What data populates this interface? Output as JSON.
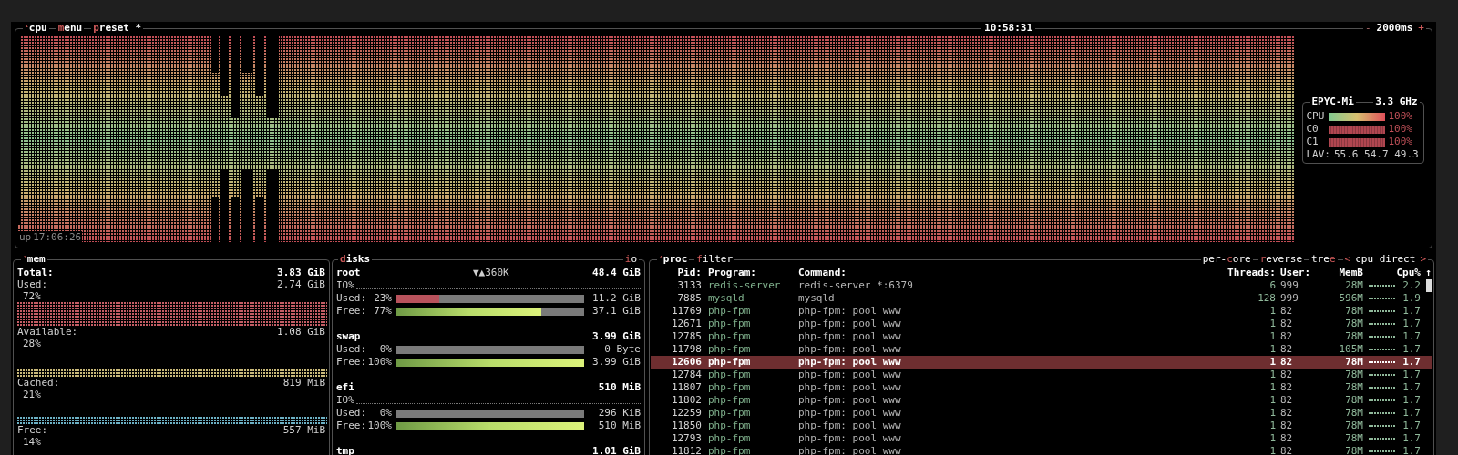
{
  "cpu_panel": {
    "number": "¹",
    "title": "cpu",
    "buttons": [
      {
        "key": "m",
        "label": "enu"
      },
      {
        "key": "p",
        "label": "reset *"
      }
    ],
    "clock": "10:58:31",
    "interval": {
      "minus": "-",
      "value": "2000ms",
      "plus": "+"
    },
    "uptime_label": "up",
    "uptime": "17:06:26",
    "info": {
      "model": "EPYC-Mi",
      "freq": "3.3 GHz",
      "meters": [
        {
          "label": "CPU",
          "kind": "gradient",
          "level": 1,
          "reading": "100%"
        },
        {
          "label": "C0",
          "kind": "dots",
          "level": 1,
          "reading": "100%"
        },
        {
          "label": "C1",
          "kind": "dots",
          "level": 1,
          "reading": "100%"
        }
      ],
      "load_label": "LAV:",
      "load": "55.6 54.7 49.3"
    }
  },
  "mem_panel": {
    "number": "²",
    "title": "mem",
    "total_label": "Total:",
    "total": "3.83 GiB",
    "items": [
      {
        "label": "Used:",
        "value": "2.74 GiB",
        "percent": "72%",
        "color": "#c45c64"
      },
      {
        "label": "Available:",
        "value": "1.08 GiB",
        "percent": "28%",
        "color": "#c9b97a"
      },
      {
        "label": "Cached:",
        "value": "819 MiB",
        "percent": "21%",
        "color": "#6cb0c4"
      },
      {
        "label": "Free:",
        "value": "557 MiB",
        "percent": "14%"
      }
    ]
  },
  "disks_panel": {
    "title_key": "d",
    "title": "isks",
    "io_key": "i",
    "io": "o",
    "disks": [
      {
        "name": "root",
        "io_speed": "▼▲360K",
        "size": "48.4 GiB",
        "io_label": "IO%",
        "meters": [
          {
            "kind": "used",
            "label": "Used:",
            "percent": "23%",
            "level": 0.23,
            "value": "11.2 GiB"
          },
          {
            "kind": "free",
            "label": "Free:",
            "percent": "77%",
            "level": 0.77,
            "value": "37.1 GiB"
          }
        ]
      },
      {
        "name": "swap",
        "size": "3.99 GiB",
        "meters": [
          {
            "kind": "used",
            "label": "Used:",
            "percent": "0%",
            "level": 0,
            "value": "0 Byte"
          },
          {
            "kind": "free",
            "label": "Free:",
            "percent": "100%",
            "level": 1,
            "value": "3.99 GiB"
          }
        ]
      },
      {
        "name": "efi",
        "size": "510 MiB",
        "io_label": "IO%",
        "meters": [
          {
            "kind": "used",
            "label": "Used:",
            "percent": "0%",
            "level": 0,
            "value": "296 KiB"
          },
          {
            "kind": "free",
            "label": "Free:",
            "percent": "100%",
            "level": 1,
            "value": "510 MiB"
          }
        ]
      },
      {
        "name": "tmp",
        "size": "1.01 GiB"
      }
    ]
  },
  "proc_panel": {
    "number": "⁴",
    "title": "proc",
    "filter": {
      "key": "f",
      "label": "ilter"
    },
    "options": [
      {
        "pre": "per-",
        "key": "c",
        "post": "ore"
      },
      {
        "key": "r",
        "post": "everse"
      },
      {
        "pre": "tre",
        "key": "e"
      }
    ],
    "sort": {
      "prev": "<",
      "label": "cpu direct",
      "next": ">"
    },
    "columns": [
      "Pid:",
      "Program:",
      "Command:",
      "Threads:",
      "User:",
      "MemB",
      "Cpu%"
    ],
    "sort_arrow": "↑",
    "rows": [
      {
        "pid": "3133",
        "program": "redis-server",
        "command": "redis-server *:6379",
        "threads": "6",
        "user": "999",
        "mem": "28M",
        "cpu": "2.2",
        "selected": false
      },
      {
        "pid": "7885",
        "program": "mysqld",
        "command": "mysqld",
        "threads": "128",
        "user": "999",
        "mem": "596M",
        "cpu": "1.9",
        "selected": false
      },
      {
        "pid": "11769",
        "program": "php-fpm",
        "command": "php-fpm: pool www",
        "threads": "1",
        "user": "82",
        "mem": "78M",
        "cpu": "1.7",
        "selected": false
      },
      {
        "pid": "12671",
        "program": "php-fpm",
        "command": "php-fpm: pool www",
        "threads": "1",
        "user": "82",
        "mem": "78M",
        "cpu": "1.7",
        "selected": false
      },
      {
        "pid": "12785",
        "program": "php-fpm",
        "command": "php-fpm: pool www",
        "threads": "1",
        "user": "82",
        "mem": "78M",
        "cpu": "1.7",
        "selected": false
      },
      {
        "pid": "11798",
        "program": "php-fpm",
        "command": "php-fpm: pool www",
        "threads": "1",
        "user": "82",
        "mem": "105M",
        "cpu": "1.7",
        "selected": false
      },
      {
        "pid": "12606",
        "program": "php-fpm",
        "command": "php-fpm: pool www",
        "threads": "1",
        "user": "82",
        "mem": "78M",
        "cpu": "1.7",
        "selected": true
      },
      {
        "pid": "12784",
        "program": "php-fpm",
        "command": "php-fpm: pool www",
        "threads": "1",
        "user": "82",
        "mem": "78M",
        "cpu": "1.7",
        "selected": false
      },
      {
        "pid": "11807",
        "program": "php-fpm",
        "command": "php-fpm: pool www",
        "threads": "1",
        "user": "82",
        "mem": "78M",
        "cpu": "1.7",
        "selected": false
      },
      {
        "pid": "11802",
        "program": "php-fpm",
        "command": "php-fpm: pool www",
        "threads": "1",
        "user": "82",
        "mem": "78M",
        "cpu": "1.7",
        "selected": false
      },
      {
        "pid": "12259",
        "program": "php-fpm",
        "command": "php-fpm: pool www",
        "threads": "1",
        "user": "82",
        "mem": "78M",
        "cpu": "1.7",
        "selected": false
      },
      {
        "pid": "11850",
        "program": "php-fpm",
        "command": "php-fpm: pool www",
        "threads": "1",
        "user": "82",
        "mem": "78M",
        "cpu": "1.7",
        "selected": false
      },
      {
        "pid": "12793",
        "program": "php-fpm",
        "command": "php-fpm: pool www",
        "threads": "1",
        "user": "82",
        "mem": "78M",
        "cpu": "1.7",
        "selected": false
      },
      {
        "pid": "11812",
        "program": "php-fpm",
        "command": "php-fpm: pool www",
        "threads": "1",
        "user": "82",
        "mem": "78M",
        "cpu": "1.7",
        "selected": false
      }
    ]
  }
}
